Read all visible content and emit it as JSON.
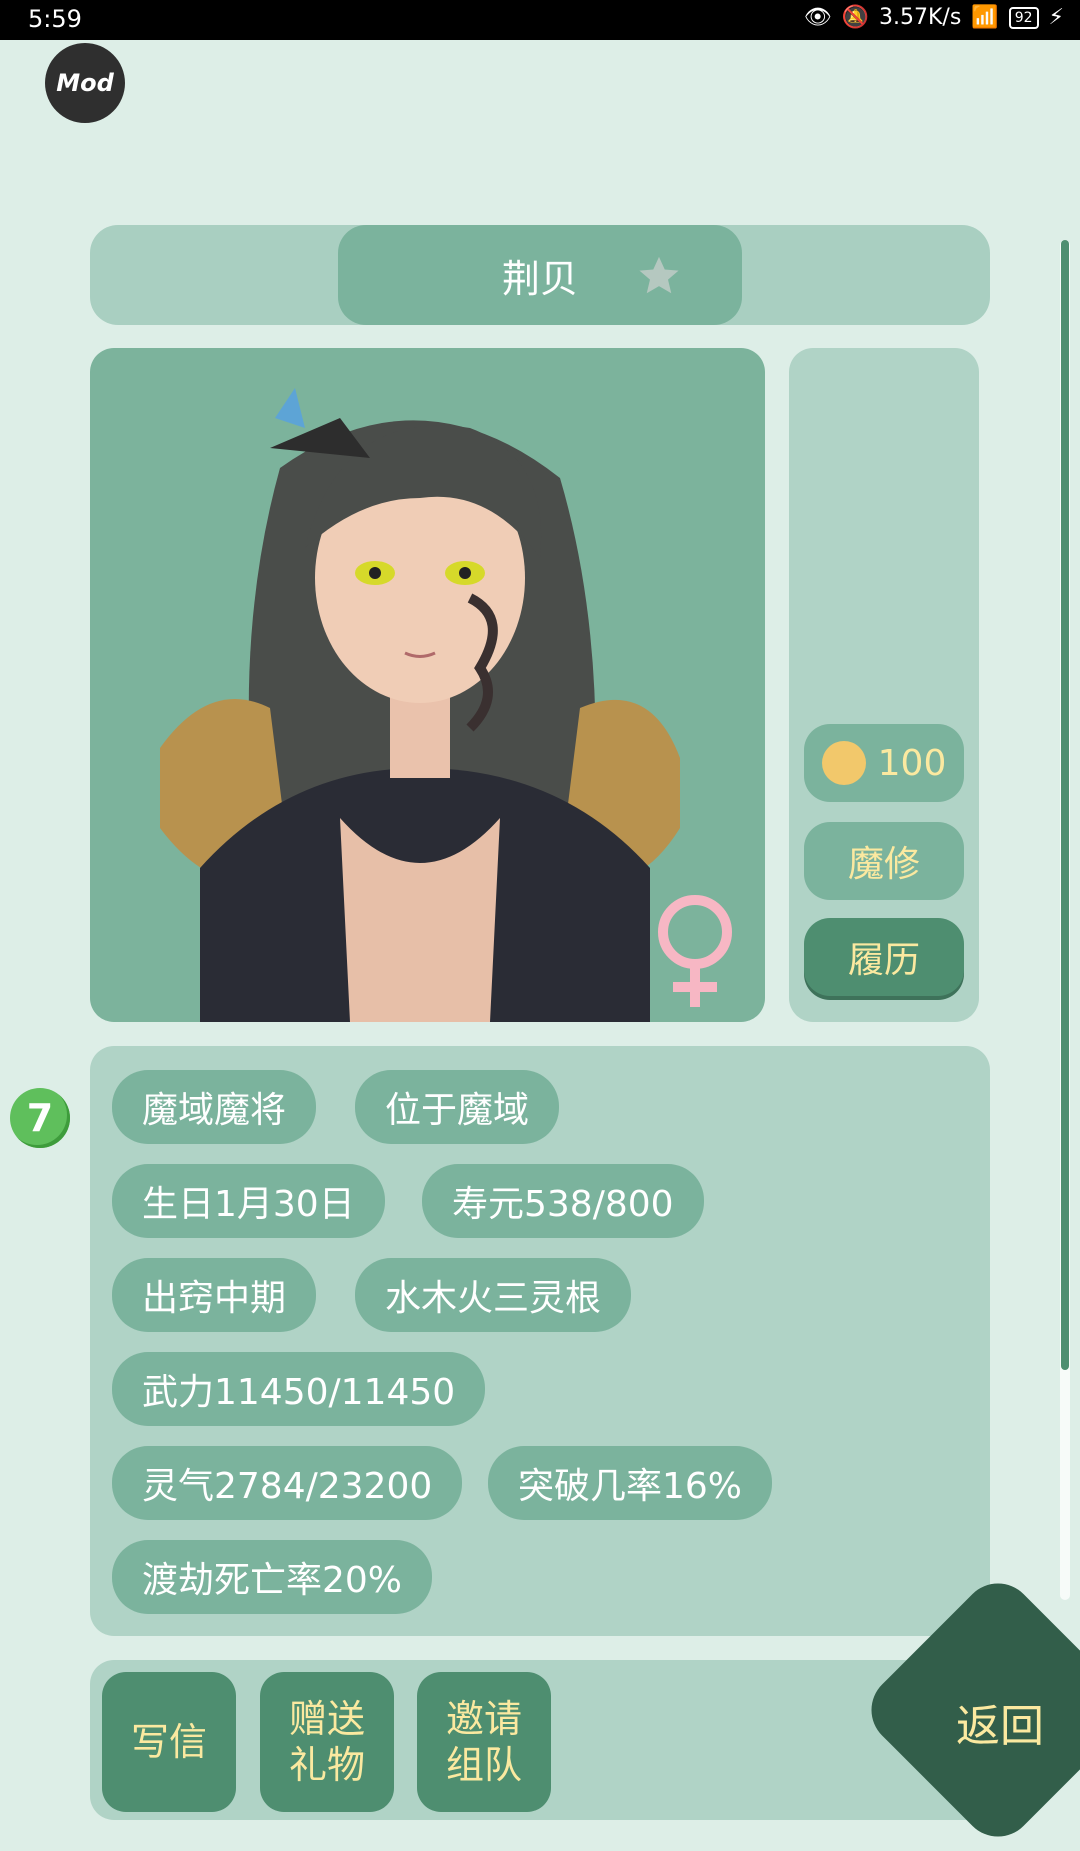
{
  "status_bar": {
    "time": "5:59",
    "net_speed": "3.57K/s",
    "battery": "92"
  },
  "mod_badge": "Mod",
  "character": {
    "name": "荆贝",
    "favorability": "100",
    "cultivation_type": "魔修",
    "history_button": "履历"
  },
  "level_badge": "7",
  "info_tags": [
    "魔域魔将",
    "位于魔域",
    "生日1月30日",
    "寿元538/800",
    "出窍中期",
    "水木火三灵根",
    "武力11450/11450",
    "灵气2784/23200",
    "突破几率16%",
    "渡劫死亡率20%"
  ],
  "actions": {
    "write_letter": "写信",
    "gift_line1": "赠送",
    "gift_line2": "礼物",
    "invite_line1": "邀请",
    "invite_line2": "组队",
    "back": "返回"
  },
  "colors": {
    "background": "#ddeee7",
    "panel": "#b0d3c6",
    "tag": "#7bb39d",
    "button_dark": "#4e8e70",
    "accent_text": "#fbe9a0"
  }
}
